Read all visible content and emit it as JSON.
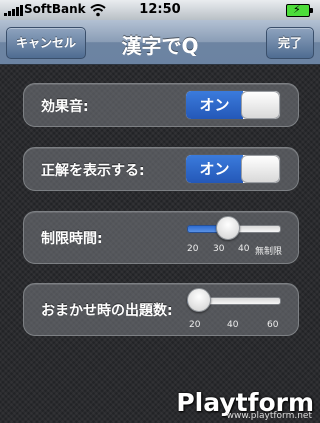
{
  "status_bar": {
    "carrier": "SoftBank",
    "time": "12:50",
    "icons": [
      "signal-icon",
      "wifi-icon",
      "battery-charging-icon"
    ]
  },
  "nav": {
    "cancel_label": "キャンセル",
    "title": "漢字でQ",
    "done_label": "完了"
  },
  "settings": {
    "sound_effects": {
      "label": "効果音:",
      "toggle_text": "オン",
      "on": true
    },
    "show_answer": {
      "label": "正解を表示する:",
      "toggle_text": "オン",
      "on": true
    },
    "time_limit": {
      "label": "制限時間:",
      "ticks": [
        "20",
        "30",
        "40",
        "無制限"
      ],
      "value_fraction": 0.4
    },
    "random_count": {
      "label": "おまかせ時の出題数:",
      "ticks": [
        "20",
        "40",
        "60"
      ],
      "value_fraction": 0.0
    }
  },
  "watermark": {
    "logo": "Playtform",
    "url": "www.playtform.net"
  },
  "colors": {
    "accent": "#2d66c9",
    "nav_top": "#b3c1d3",
    "nav_bottom": "#6b83a2"
  }
}
